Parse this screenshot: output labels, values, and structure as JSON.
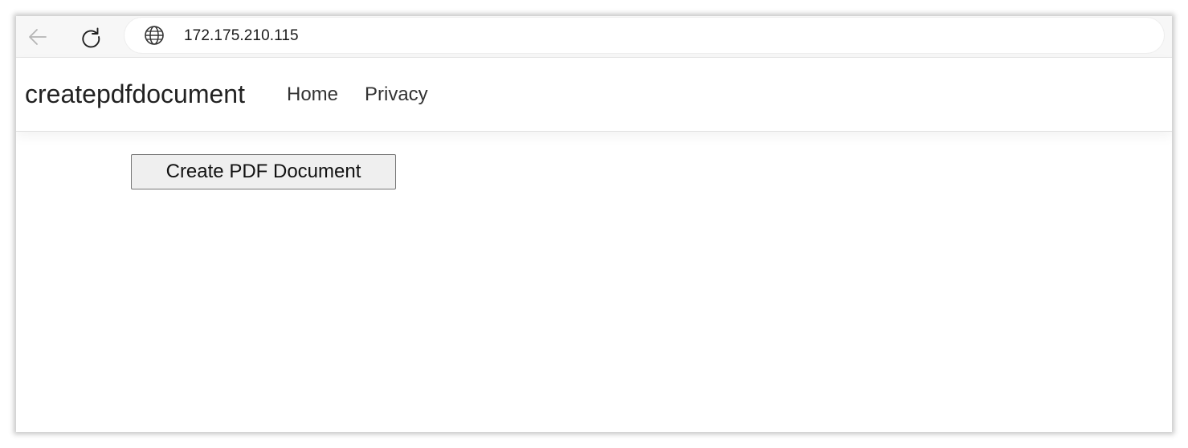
{
  "browser": {
    "address": "172.175.210.115",
    "back_icon": "arrow-left-icon",
    "reload_icon": "reload-icon",
    "site_icon": "globe-icon"
  },
  "navbar": {
    "brand": "createpdfdocument",
    "links": [
      {
        "label": "Home"
      },
      {
        "label": "Privacy"
      }
    ]
  },
  "main": {
    "create_button_label": "Create PDF Document"
  },
  "colors": {
    "toolbar_bg": "#f7f7f7",
    "page_bg": "#ffffff",
    "button_bg": "#efefef",
    "button_border": "#767676",
    "text": "#222222"
  }
}
